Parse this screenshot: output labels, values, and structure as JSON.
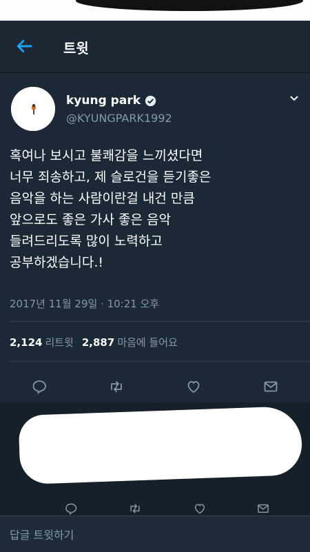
{
  "header": {
    "title": "트윗"
  },
  "tweet": {
    "author_name": "kyung park",
    "handle": "@KYUNGPARK1992",
    "text_lines": [
      "혹여나 보시고 불쾌감을 느끼셨다면",
      "너무 죄송하고, 제 슬로건을 듣기좋은",
      "음악을 하는 사람이란걸 내건 만큼",
      "앞으로도 좋은 가사 좋은 음악",
      "들려드리도록 많이 노력하고",
      "공부하겠습니다.!"
    ],
    "timestamp": "2017년 11월 29일 · 10:21 오후",
    "retweet_count": "2,124",
    "retweet_label": "리트윗",
    "like_count": "2,887",
    "like_label": "마음에 들어요"
  },
  "composer": {
    "placeholder": "답글 트윗하기"
  },
  "icons": {
    "back": "back-arrow-icon",
    "verified": "verified-badge-icon",
    "more": "chevron-down-icon",
    "reply": "reply-icon",
    "retweet": "retweet-icon",
    "like": "heart-icon",
    "dm": "envelope-icon"
  },
  "colors": {
    "accent": "#1da1f2",
    "background": "#15202b",
    "muted": "#8899a6"
  }
}
